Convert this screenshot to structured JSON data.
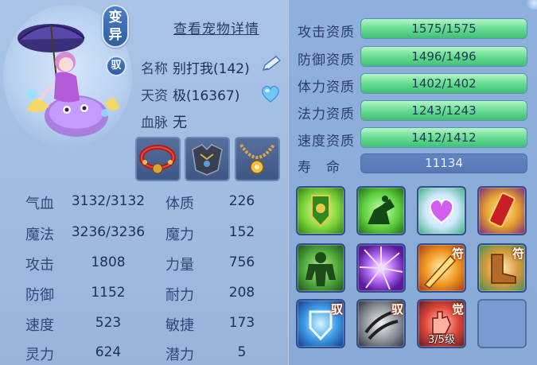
{
  "header": {
    "badge_variant": "变异",
    "badge_tame": "驭",
    "detail_link": "查看宠物详情"
  },
  "info": {
    "name_label": "名称",
    "name_value": "别打我(142)",
    "talent_label": "天资",
    "talent_value": "极(16367)",
    "blood_label": "血脉",
    "blood_value": "无"
  },
  "stats": [
    {
      "label": "气血",
      "value": "3132/3132"
    },
    {
      "label": "魔法",
      "value": "3236/3236"
    },
    {
      "label": "攻击",
      "value": "1808"
    },
    {
      "label": "防御",
      "value": "1152"
    },
    {
      "label": "速度",
      "value": "523"
    },
    {
      "label": "灵力",
      "value": "624"
    }
  ],
  "attributes": [
    {
      "label": "体质",
      "value": "226"
    },
    {
      "label": "魔力",
      "value": "152"
    },
    {
      "label": "力量",
      "value": "756"
    },
    {
      "label": "耐力",
      "value": "208"
    },
    {
      "label": "敏捷",
      "value": "173"
    },
    {
      "label": "潜力",
      "value": "5"
    }
  ],
  "aptitudes": [
    {
      "label": "攻击资质",
      "value": "1575/1575",
      "fraction": 1.0
    },
    {
      "label": "防御资质",
      "value": "1496/1496",
      "fraction": 1.0
    },
    {
      "label": "体力资质",
      "value": "1402/1402",
      "fraction": 1.0
    },
    {
      "label": "法力资质",
      "value": "1243/1243",
      "fraction": 1.0
    },
    {
      "label": "速度资质",
      "value": "1412/1412",
      "fraction": 1.0
    }
  ],
  "life": {
    "label": "寿　命",
    "value": "11134"
  },
  "skills": [
    {
      "icon": "shield-badge-icon",
      "tag": "",
      "level": ""
    },
    {
      "icon": "green-rider-icon",
      "tag": "",
      "level": ""
    },
    {
      "icon": "heart-gem-icon",
      "tag": "",
      "level": ""
    },
    {
      "icon": "red-scroll-icon",
      "tag": "",
      "level": ""
    },
    {
      "icon": "green-giant-icon",
      "tag": "",
      "level": ""
    },
    {
      "icon": "purple-burst-icon",
      "tag": "",
      "level": ""
    },
    {
      "icon": "golden-blade-icon",
      "tag": "符",
      "level": ""
    },
    {
      "icon": "speed-boot-icon",
      "tag": "符",
      "level": ""
    },
    {
      "icon": "blue-shield-icon",
      "tag": "驭",
      "level": ""
    },
    {
      "icon": "grey-claw-icon",
      "tag": "驭",
      "level": ""
    },
    {
      "icon": "red-hand-icon",
      "tag": "觉",
      "level": "3/5级"
    }
  ],
  "colors": {
    "bar_fill": "#6ddf97",
    "panel_bg": "#a9c4e6",
    "tag_outline": "#a23400"
  }
}
